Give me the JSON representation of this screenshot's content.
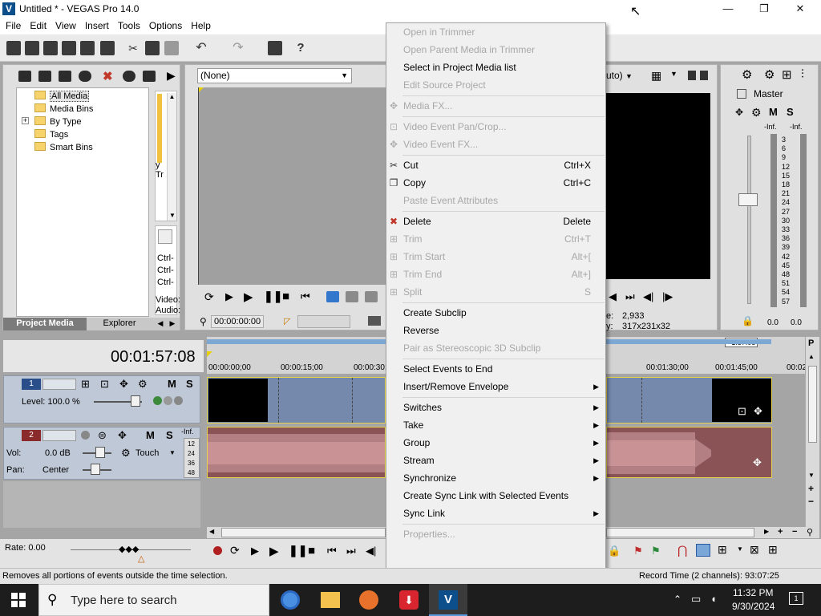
{
  "window": {
    "title": "Untitled * - VEGAS Pro 14.0",
    "app_icon_letter": "V",
    "minimize": "—",
    "maximize": "❐",
    "close": "✕"
  },
  "menubar": [
    "File",
    "Edit",
    "View",
    "Insert",
    "Tools",
    "Options",
    "Help"
  ],
  "project_media": {
    "tree": [
      "All Media",
      "Media Bins",
      "By Type",
      "Tags",
      "Smart Bins"
    ],
    "expander": "+",
    "tabs": [
      "Project Media",
      "Explorer"
    ],
    "side_labels": [
      "Ctrl-",
      "Ctrl-",
      "Ctrl-",
      "Video:",
      "Audio:"
    ],
    "side_scrap": [
      "y",
      "Tr"
    ]
  },
  "trimmer": {
    "dropdown_value": "(None)",
    "timecode": "00:00:00:00"
  },
  "preview": {
    "quality": "uto)",
    "frame_label": "e:",
    "frame_value": "2,933",
    "display_label": "y:",
    "display_value": "317x231x32"
  },
  "master": {
    "label": "Master",
    "meter_left_top": "-Inf.",
    "meter_right_top": "-Inf.",
    "ticks": [
      "3",
      "6",
      "9",
      "12",
      "15",
      "18",
      "21",
      "24",
      "27",
      "30",
      "33",
      "36",
      "39",
      "42",
      "45",
      "48",
      "51",
      "54",
      "57"
    ],
    "value_left": "0.0",
    "value_right": "0.0"
  },
  "timeline": {
    "current_time": "00:01:57:08",
    "end_marker": "+1:57:08",
    "ruler": [
      "00:00:00;00",
      "00:00:15;00",
      "00:00:30;",
      "00:01:30;00",
      "00:01:45;00",
      "00:02:"
    ],
    "rate": "Rate: 0.00"
  },
  "video_track": {
    "number": "1",
    "level": "Level: 100.0 %"
  },
  "audio_track": {
    "number": "2",
    "vol_label": "Vol:",
    "vol_value": "0.0 dB",
    "pan_label": "Pan:",
    "pan_value": "Center",
    "automation": "Touch",
    "meter_top": "-Inf.",
    "meter_ticks": [
      "12",
      "24",
      "36",
      "48"
    ]
  },
  "context_menu": {
    "groups": [
      [
        {
          "label": "Open in Trimmer",
          "disabled": true
        },
        {
          "label": "Open Parent Media in Trimmer",
          "disabled": true
        },
        {
          "label": "Select in Project Media list",
          "disabled": false
        },
        {
          "label": "Edit Source Project",
          "disabled": true
        }
      ],
      [
        {
          "label": "Media FX...",
          "disabled": true,
          "icon": "fx"
        }
      ],
      [
        {
          "label": "Video Event Pan/Crop...",
          "disabled": true,
          "icon": "crop"
        },
        {
          "label": "Video Event FX...",
          "disabled": true,
          "icon": "fx"
        }
      ],
      [
        {
          "label": "Cut",
          "shortcut": "Ctrl+X",
          "disabled": false,
          "icon": "cut"
        },
        {
          "label": "Copy",
          "shortcut": "Ctrl+C",
          "disabled": false,
          "icon": "copy"
        },
        {
          "label": "Paste Event Attributes",
          "disabled": true
        }
      ],
      [
        {
          "label": "Delete",
          "shortcut": "Delete",
          "disabled": false,
          "icon": "delete"
        },
        {
          "label": "Trim",
          "shortcut": "Ctrl+T",
          "disabled": true,
          "icon": "trim"
        },
        {
          "label": "Trim Start",
          "shortcut": "Alt+[",
          "disabled": true,
          "icon": "trim"
        },
        {
          "label": "Trim End",
          "shortcut": "Alt+]",
          "disabled": true,
          "icon": "trim"
        },
        {
          "label": "Split",
          "shortcut": "S",
          "disabled": true,
          "icon": "trim"
        }
      ],
      [
        {
          "label": "Create Subclip",
          "disabled": false
        },
        {
          "label": "Reverse",
          "disabled": false
        },
        {
          "label": "Pair as Stereoscopic 3D Subclip",
          "disabled": true
        }
      ],
      [
        {
          "label": "Select Events to End",
          "disabled": false
        },
        {
          "label": "Insert/Remove Envelope",
          "disabled": false,
          "submenu": true
        }
      ],
      [
        {
          "label": "Switches",
          "disabled": false,
          "submenu": true
        },
        {
          "label": "Take",
          "disabled": false,
          "submenu": true
        },
        {
          "label": "Group",
          "disabled": false,
          "submenu": true
        },
        {
          "label": "Stream",
          "disabled": false,
          "submenu": true
        },
        {
          "label": "Synchronize",
          "disabled": false,
          "submenu": true
        },
        {
          "label": "Create Sync Link with Selected Events",
          "disabled": false
        },
        {
          "label": "Sync Link",
          "disabled": false,
          "submenu": true
        }
      ],
      [
        {
          "label": "Properties...",
          "disabled": true
        }
      ]
    ],
    "submenu_arrow": "▶"
  },
  "status": {
    "left": "Removes all portions of events outside the time selection.",
    "right": "Record Time (2 channels): 93:07:25"
  },
  "taskbar": {
    "search_placeholder": "Type here to search",
    "time": "11:32 PM",
    "date": "9/30/2024"
  }
}
